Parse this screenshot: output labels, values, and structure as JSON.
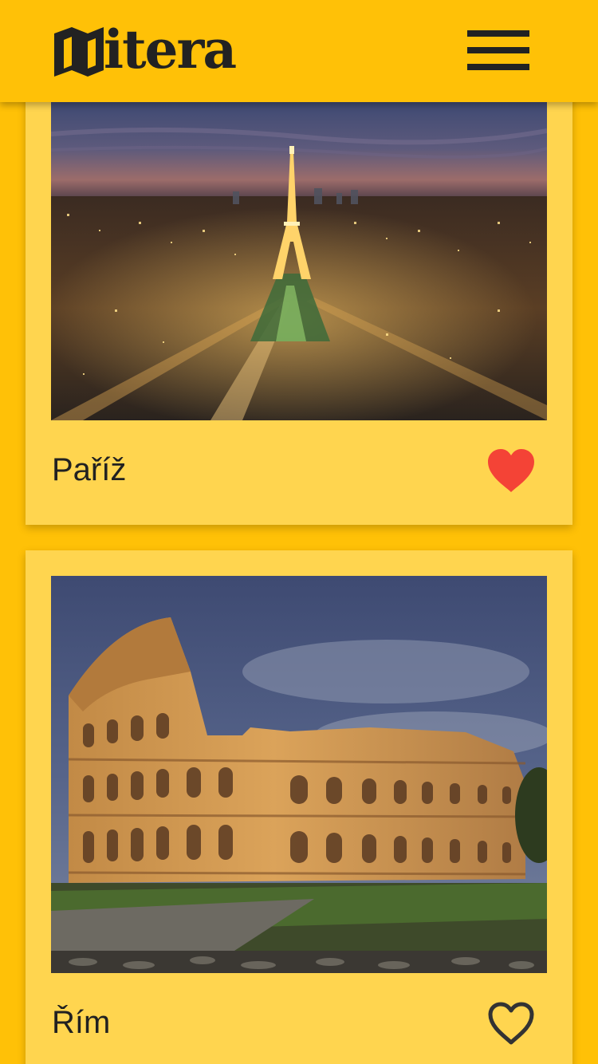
{
  "app": {
    "brand": "itera",
    "brand_mark_icon": "map-icon",
    "menu_icon": "hamburger-menu-icon"
  },
  "colors": {
    "background": "#FFC107",
    "card": "#FFD54F",
    "text": "#212121",
    "favorite_active": "#F44336",
    "favorite_inactive": "#333333"
  },
  "cities": [
    {
      "name": "Paříž",
      "image": "eiffel-tower-night-photo",
      "favorite": true,
      "favorite_icon": "heart-filled-icon"
    },
    {
      "name": "Řím",
      "image": "colosseum-photo",
      "favorite": false,
      "favorite_icon": "heart-outline-icon"
    }
  ]
}
